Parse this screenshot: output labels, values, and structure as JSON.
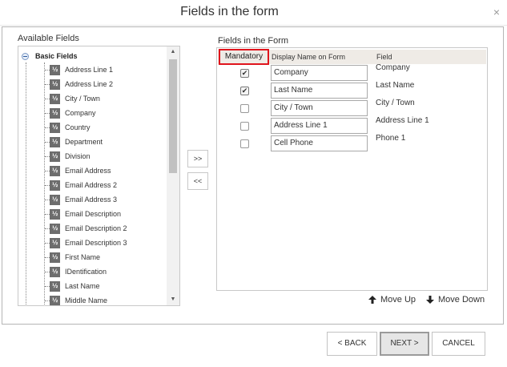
{
  "dialog": {
    "title": "Fields in the form",
    "close_glyph": "×"
  },
  "available": {
    "label": "Available Fields",
    "root": "Basic Fields",
    "icon_glyph": "½",
    "items": [
      "Address Line 1",
      "Address Line 2",
      "City / Town",
      "Company",
      "Country",
      "Department",
      "Division",
      "Email Address",
      "Email Address 2",
      "Email Address 3",
      "Email Description",
      "Email Description 2",
      "Email Description 3",
      "First Name",
      "IDentification",
      "Last Name",
      "Middle Name"
    ]
  },
  "transfer": {
    "add_label": ">>",
    "remove_label": "<<"
  },
  "form": {
    "label": "Fields in the Form",
    "headers": {
      "mandatory": "Mandatory",
      "display_name": "Display Name on Form",
      "field": "Field"
    },
    "rows": [
      {
        "mandatory": true,
        "display_name": "Company",
        "field": "Company"
      },
      {
        "mandatory": true,
        "display_name": "Last Name",
        "field": "Last Name"
      },
      {
        "mandatory": false,
        "display_name": "City / Town",
        "field": "City / Town"
      },
      {
        "mandatory": false,
        "display_name": "Address Line 1",
        "field": "Address Line 1"
      },
      {
        "mandatory": false,
        "display_name": "Cell Phone",
        "field": "Phone 1"
      }
    ]
  },
  "ordering": {
    "move_up": "Move Up",
    "move_down": "Move Down"
  },
  "footer": {
    "back": "< BACK",
    "next": "NEXT >",
    "cancel": "CANCEL"
  },
  "colors": {
    "highlight": "#e0141c",
    "header_bg": "#efebe6"
  },
  "icons": {
    "field_icon": "field-type-icon",
    "up": "arrow-up-icon",
    "down": "arrow-down-icon"
  }
}
